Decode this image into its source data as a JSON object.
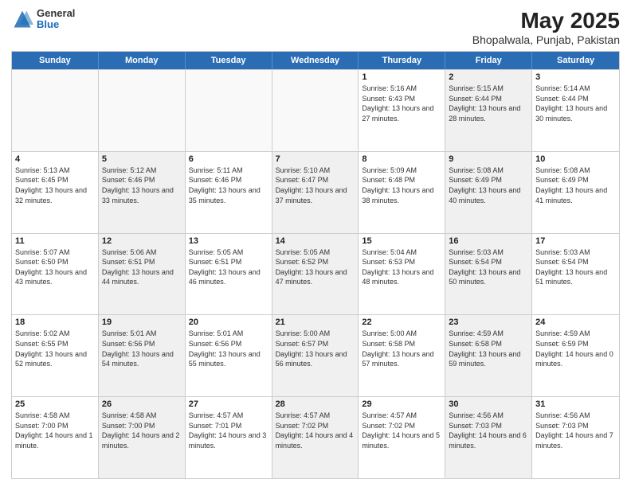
{
  "header": {
    "logo_general": "General",
    "logo_blue": "Blue",
    "title": "May 2025",
    "subtitle": "Bhopalwala, Punjab, Pakistan"
  },
  "days_of_week": [
    "Sunday",
    "Monday",
    "Tuesday",
    "Wednesday",
    "Thursday",
    "Friday",
    "Saturday"
  ],
  "rows": [
    [
      {
        "day": "",
        "sunrise": "",
        "sunset": "",
        "daylight": "",
        "shaded": false,
        "empty": true
      },
      {
        "day": "",
        "sunrise": "",
        "sunset": "",
        "daylight": "",
        "shaded": false,
        "empty": true
      },
      {
        "day": "",
        "sunrise": "",
        "sunset": "",
        "daylight": "",
        "shaded": false,
        "empty": true
      },
      {
        "day": "",
        "sunrise": "",
        "sunset": "",
        "daylight": "",
        "shaded": false,
        "empty": true
      },
      {
        "day": "1",
        "sunrise": "Sunrise: 5:16 AM",
        "sunset": "Sunset: 6:43 PM",
        "daylight": "Daylight: 13 hours and 27 minutes.",
        "shaded": false,
        "empty": false
      },
      {
        "day": "2",
        "sunrise": "Sunrise: 5:15 AM",
        "sunset": "Sunset: 6:44 PM",
        "daylight": "Daylight: 13 hours and 28 minutes.",
        "shaded": true,
        "empty": false
      },
      {
        "day": "3",
        "sunrise": "Sunrise: 5:14 AM",
        "sunset": "Sunset: 6:44 PM",
        "daylight": "Daylight: 13 hours and 30 minutes.",
        "shaded": false,
        "empty": false
      }
    ],
    [
      {
        "day": "4",
        "sunrise": "Sunrise: 5:13 AM",
        "sunset": "Sunset: 6:45 PM",
        "daylight": "Daylight: 13 hours and 32 minutes.",
        "shaded": false,
        "empty": false
      },
      {
        "day": "5",
        "sunrise": "Sunrise: 5:12 AM",
        "sunset": "Sunset: 6:46 PM",
        "daylight": "Daylight: 13 hours and 33 minutes.",
        "shaded": true,
        "empty": false
      },
      {
        "day": "6",
        "sunrise": "Sunrise: 5:11 AM",
        "sunset": "Sunset: 6:46 PM",
        "daylight": "Daylight: 13 hours and 35 minutes.",
        "shaded": false,
        "empty": false
      },
      {
        "day": "7",
        "sunrise": "Sunrise: 5:10 AM",
        "sunset": "Sunset: 6:47 PM",
        "daylight": "Daylight: 13 hours and 37 minutes.",
        "shaded": true,
        "empty": false
      },
      {
        "day": "8",
        "sunrise": "Sunrise: 5:09 AM",
        "sunset": "Sunset: 6:48 PM",
        "daylight": "Daylight: 13 hours and 38 minutes.",
        "shaded": false,
        "empty": false
      },
      {
        "day": "9",
        "sunrise": "Sunrise: 5:08 AM",
        "sunset": "Sunset: 6:49 PM",
        "daylight": "Daylight: 13 hours and 40 minutes.",
        "shaded": true,
        "empty": false
      },
      {
        "day": "10",
        "sunrise": "Sunrise: 5:08 AM",
        "sunset": "Sunset: 6:49 PM",
        "daylight": "Daylight: 13 hours and 41 minutes.",
        "shaded": false,
        "empty": false
      }
    ],
    [
      {
        "day": "11",
        "sunrise": "Sunrise: 5:07 AM",
        "sunset": "Sunset: 6:50 PM",
        "daylight": "Daylight: 13 hours and 43 minutes.",
        "shaded": false,
        "empty": false
      },
      {
        "day": "12",
        "sunrise": "Sunrise: 5:06 AM",
        "sunset": "Sunset: 6:51 PM",
        "daylight": "Daylight: 13 hours and 44 minutes.",
        "shaded": true,
        "empty": false
      },
      {
        "day": "13",
        "sunrise": "Sunrise: 5:05 AM",
        "sunset": "Sunset: 6:51 PM",
        "daylight": "Daylight: 13 hours and 46 minutes.",
        "shaded": false,
        "empty": false
      },
      {
        "day": "14",
        "sunrise": "Sunrise: 5:05 AM",
        "sunset": "Sunset: 6:52 PM",
        "daylight": "Daylight: 13 hours and 47 minutes.",
        "shaded": true,
        "empty": false
      },
      {
        "day": "15",
        "sunrise": "Sunrise: 5:04 AM",
        "sunset": "Sunset: 6:53 PM",
        "daylight": "Daylight: 13 hours and 48 minutes.",
        "shaded": false,
        "empty": false
      },
      {
        "day": "16",
        "sunrise": "Sunrise: 5:03 AM",
        "sunset": "Sunset: 6:54 PM",
        "daylight": "Daylight: 13 hours and 50 minutes.",
        "shaded": true,
        "empty": false
      },
      {
        "day": "17",
        "sunrise": "Sunrise: 5:03 AM",
        "sunset": "Sunset: 6:54 PM",
        "daylight": "Daylight: 13 hours and 51 minutes.",
        "shaded": false,
        "empty": false
      }
    ],
    [
      {
        "day": "18",
        "sunrise": "Sunrise: 5:02 AM",
        "sunset": "Sunset: 6:55 PM",
        "daylight": "Daylight: 13 hours and 52 minutes.",
        "shaded": false,
        "empty": false
      },
      {
        "day": "19",
        "sunrise": "Sunrise: 5:01 AM",
        "sunset": "Sunset: 6:56 PM",
        "daylight": "Daylight: 13 hours and 54 minutes.",
        "shaded": true,
        "empty": false
      },
      {
        "day": "20",
        "sunrise": "Sunrise: 5:01 AM",
        "sunset": "Sunset: 6:56 PM",
        "daylight": "Daylight: 13 hours and 55 minutes.",
        "shaded": false,
        "empty": false
      },
      {
        "day": "21",
        "sunrise": "Sunrise: 5:00 AM",
        "sunset": "Sunset: 6:57 PM",
        "daylight": "Daylight: 13 hours and 56 minutes.",
        "shaded": true,
        "empty": false
      },
      {
        "day": "22",
        "sunrise": "Sunrise: 5:00 AM",
        "sunset": "Sunset: 6:58 PM",
        "daylight": "Daylight: 13 hours and 57 minutes.",
        "shaded": false,
        "empty": false
      },
      {
        "day": "23",
        "sunrise": "Sunrise: 4:59 AM",
        "sunset": "Sunset: 6:58 PM",
        "daylight": "Daylight: 13 hours and 59 minutes.",
        "shaded": true,
        "empty": false
      },
      {
        "day": "24",
        "sunrise": "Sunrise: 4:59 AM",
        "sunset": "Sunset: 6:59 PM",
        "daylight": "Daylight: 14 hours and 0 minutes.",
        "shaded": false,
        "empty": false
      }
    ],
    [
      {
        "day": "25",
        "sunrise": "Sunrise: 4:58 AM",
        "sunset": "Sunset: 7:00 PM",
        "daylight": "Daylight: 14 hours and 1 minute.",
        "shaded": false,
        "empty": false
      },
      {
        "day": "26",
        "sunrise": "Sunrise: 4:58 AM",
        "sunset": "Sunset: 7:00 PM",
        "daylight": "Daylight: 14 hours and 2 minutes.",
        "shaded": true,
        "empty": false
      },
      {
        "day": "27",
        "sunrise": "Sunrise: 4:57 AM",
        "sunset": "Sunset: 7:01 PM",
        "daylight": "Daylight: 14 hours and 3 minutes.",
        "shaded": false,
        "empty": false
      },
      {
        "day": "28",
        "sunrise": "Sunrise: 4:57 AM",
        "sunset": "Sunset: 7:02 PM",
        "daylight": "Daylight: 14 hours and 4 minutes.",
        "shaded": true,
        "empty": false
      },
      {
        "day": "29",
        "sunrise": "Sunrise: 4:57 AM",
        "sunset": "Sunset: 7:02 PM",
        "daylight": "Daylight: 14 hours and 5 minutes.",
        "shaded": false,
        "empty": false
      },
      {
        "day": "30",
        "sunrise": "Sunrise: 4:56 AM",
        "sunset": "Sunset: 7:03 PM",
        "daylight": "Daylight: 14 hours and 6 minutes.",
        "shaded": true,
        "empty": false
      },
      {
        "day": "31",
        "sunrise": "Sunrise: 4:56 AM",
        "sunset": "Sunset: 7:03 PM",
        "daylight": "Daylight: 14 hours and 7 minutes.",
        "shaded": false,
        "empty": false
      }
    ]
  ]
}
